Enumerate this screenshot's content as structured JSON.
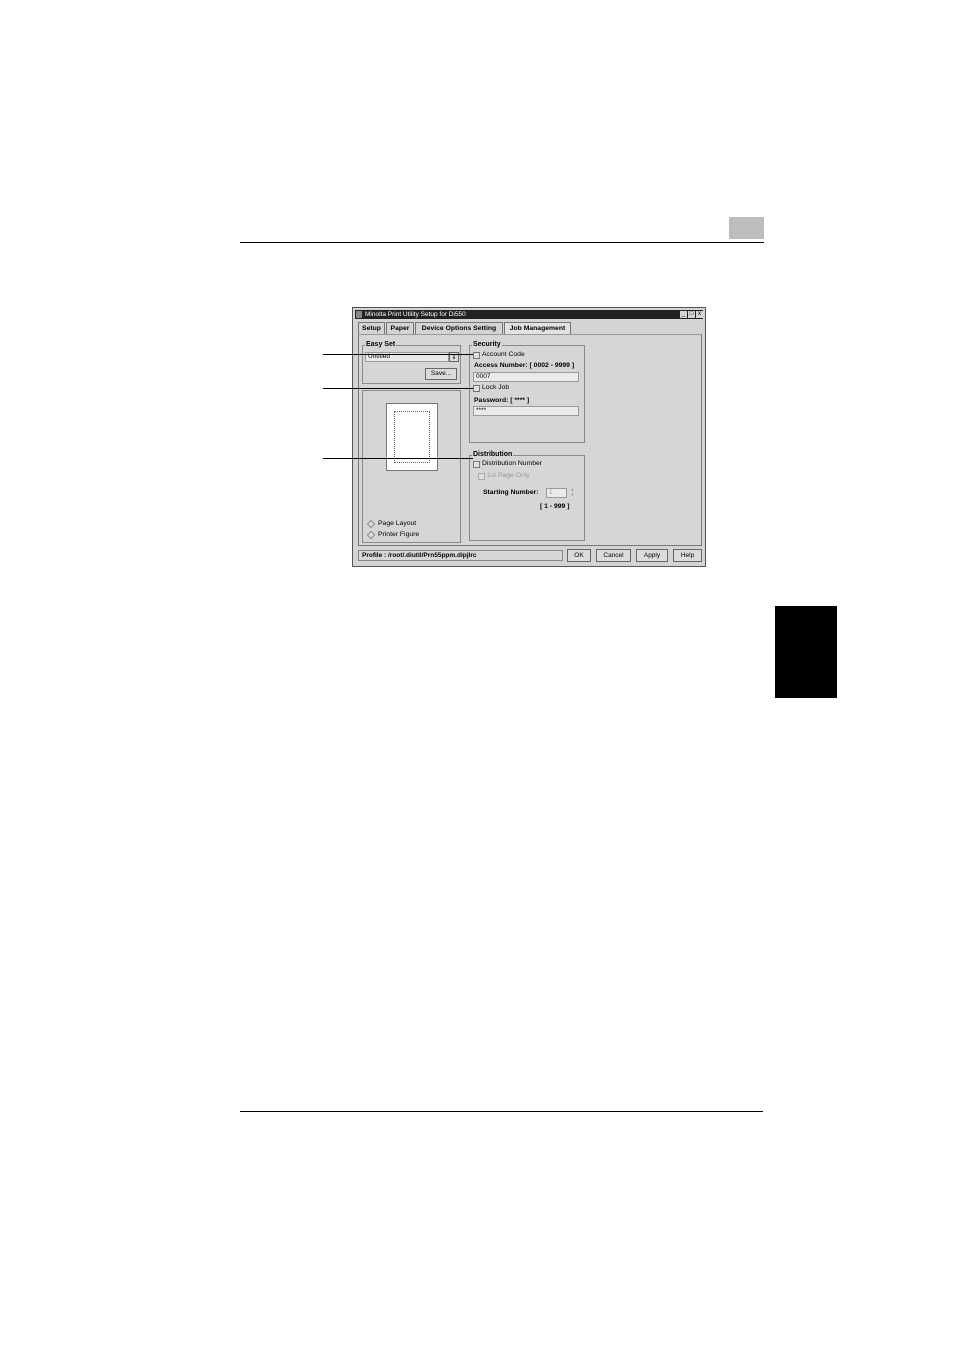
{
  "window": {
    "title": "Minolta Print Utility Setup for Di550",
    "minimize_glyph": "_",
    "maximize_glyph": "□",
    "close_glyph": "x"
  },
  "tabs": [
    {
      "label": "Setup"
    },
    {
      "label": "Paper"
    },
    {
      "label": "Device Options Setting"
    },
    {
      "label": "Job Management"
    }
  ],
  "easy_set": {
    "label": "Easy Set",
    "value": "Untitled",
    "dropdown_glyph": "⇓",
    "save_label": "Save..."
  },
  "preview_options": {
    "page_layout": "Page Layout",
    "printer_figure": "Printer Figure"
  },
  "security": {
    "label": "Security",
    "account_code": "Account Code",
    "access_number_label": "Access Number: [ 0002 - 9999 ]",
    "access_number_value": "0007",
    "lock_job": "Lock Job",
    "password_label": "Password: [ **** ]",
    "password_value": "****"
  },
  "distribution": {
    "label": "Distribution",
    "distribution_number": "Distribution Number",
    "first_page_only": "1st Page Only",
    "starting_number_label": "Starting Number:",
    "starting_number_value": "1",
    "range": "[ 1 - 999 ]"
  },
  "footer": {
    "profile": "Profile : /root/.diutil/Prn55ppm.dipjlrc",
    "ok": "OK",
    "cancel": "Cancel",
    "apply": "Apply",
    "help": "Help"
  }
}
